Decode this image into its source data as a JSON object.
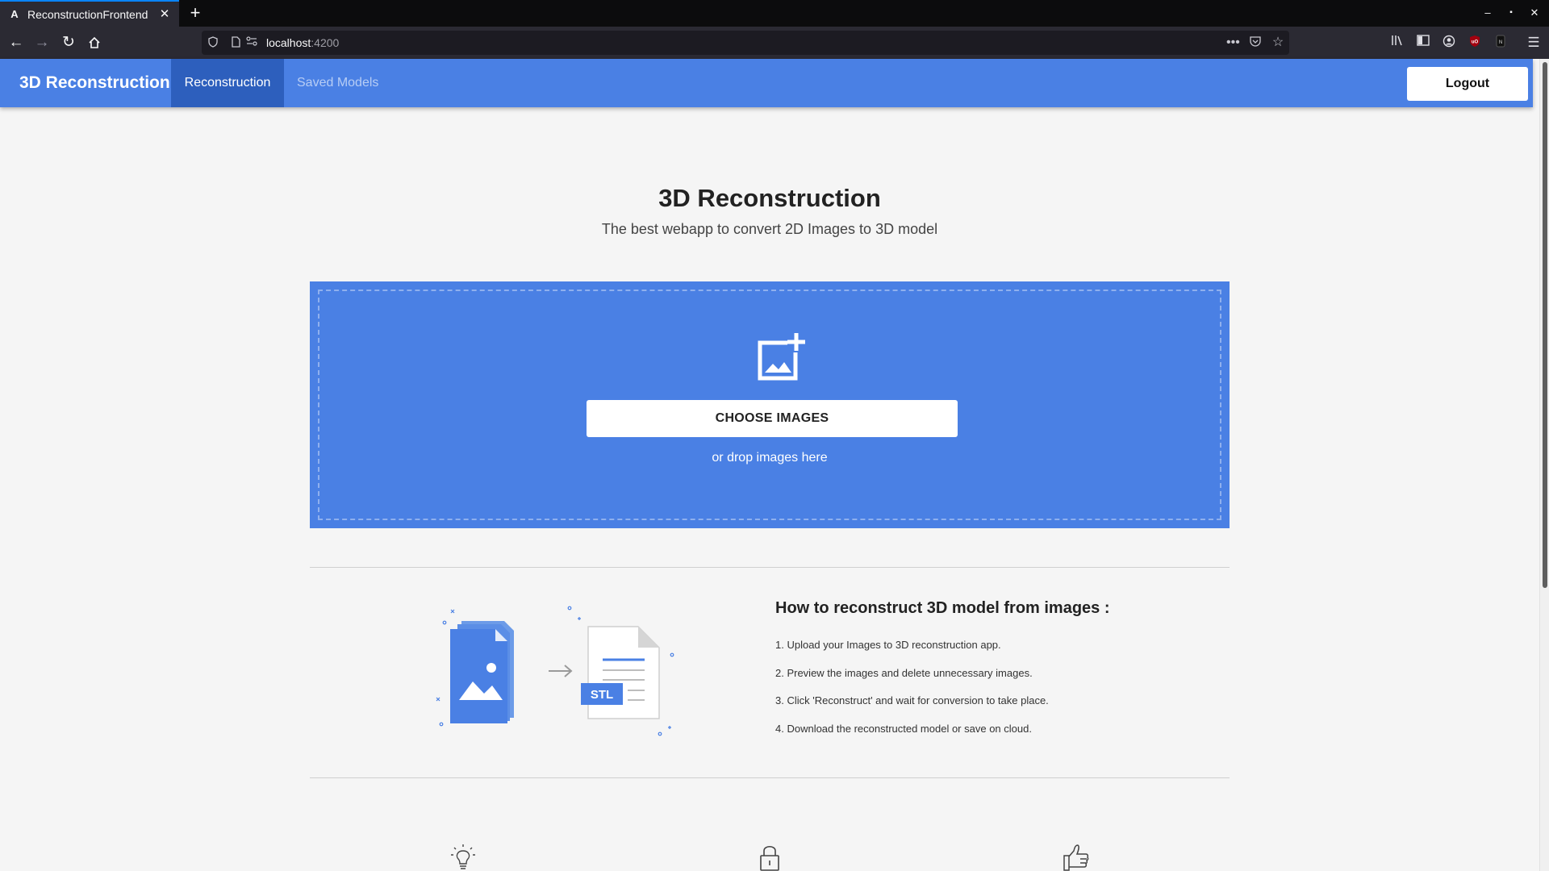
{
  "browser": {
    "tab_title": "ReconstructionFrontend",
    "tab_favicon": "A",
    "url_host": "localhost",
    "url_port": ":4200"
  },
  "header": {
    "brand": "3D Reconstruction",
    "nav": [
      {
        "label": "Reconstruction",
        "active": true
      },
      {
        "label": "Saved Models",
        "active": false
      }
    ],
    "logout_label": "Logout"
  },
  "hero": {
    "title": "3D Reconstruction",
    "subtitle": "The best webapp to convert 2D Images to 3D model"
  },
  "upload": {
    "button_label": "CHOOSE IMAGES",
    "drop_text": "or drop images here"
  },
  "howto": {
    "illustration_label": "STL",
    "title": "How to reconstruct 3D model from images :",
    "steps": [
      "1. Upload your Images to 3D reconstruction app.",
      "2. Preview the images and delete unnecessary images.",
      "3. Click 'Reconstruct' and wait for conversion to take place.",
      "4. Download the reconstructed model or save on cloud."
    ]
  },
  "features": {
    "icons": [
      "lightbulb-icon",
      "lock-icon",
      "thumbs-up-icon"
    ]
  },
  "colors": {
    "primary": "#4a80e4",
    "primary_dark": "#2d5fbd",
    "page_bg": "#f5f5f5"
  }
}
